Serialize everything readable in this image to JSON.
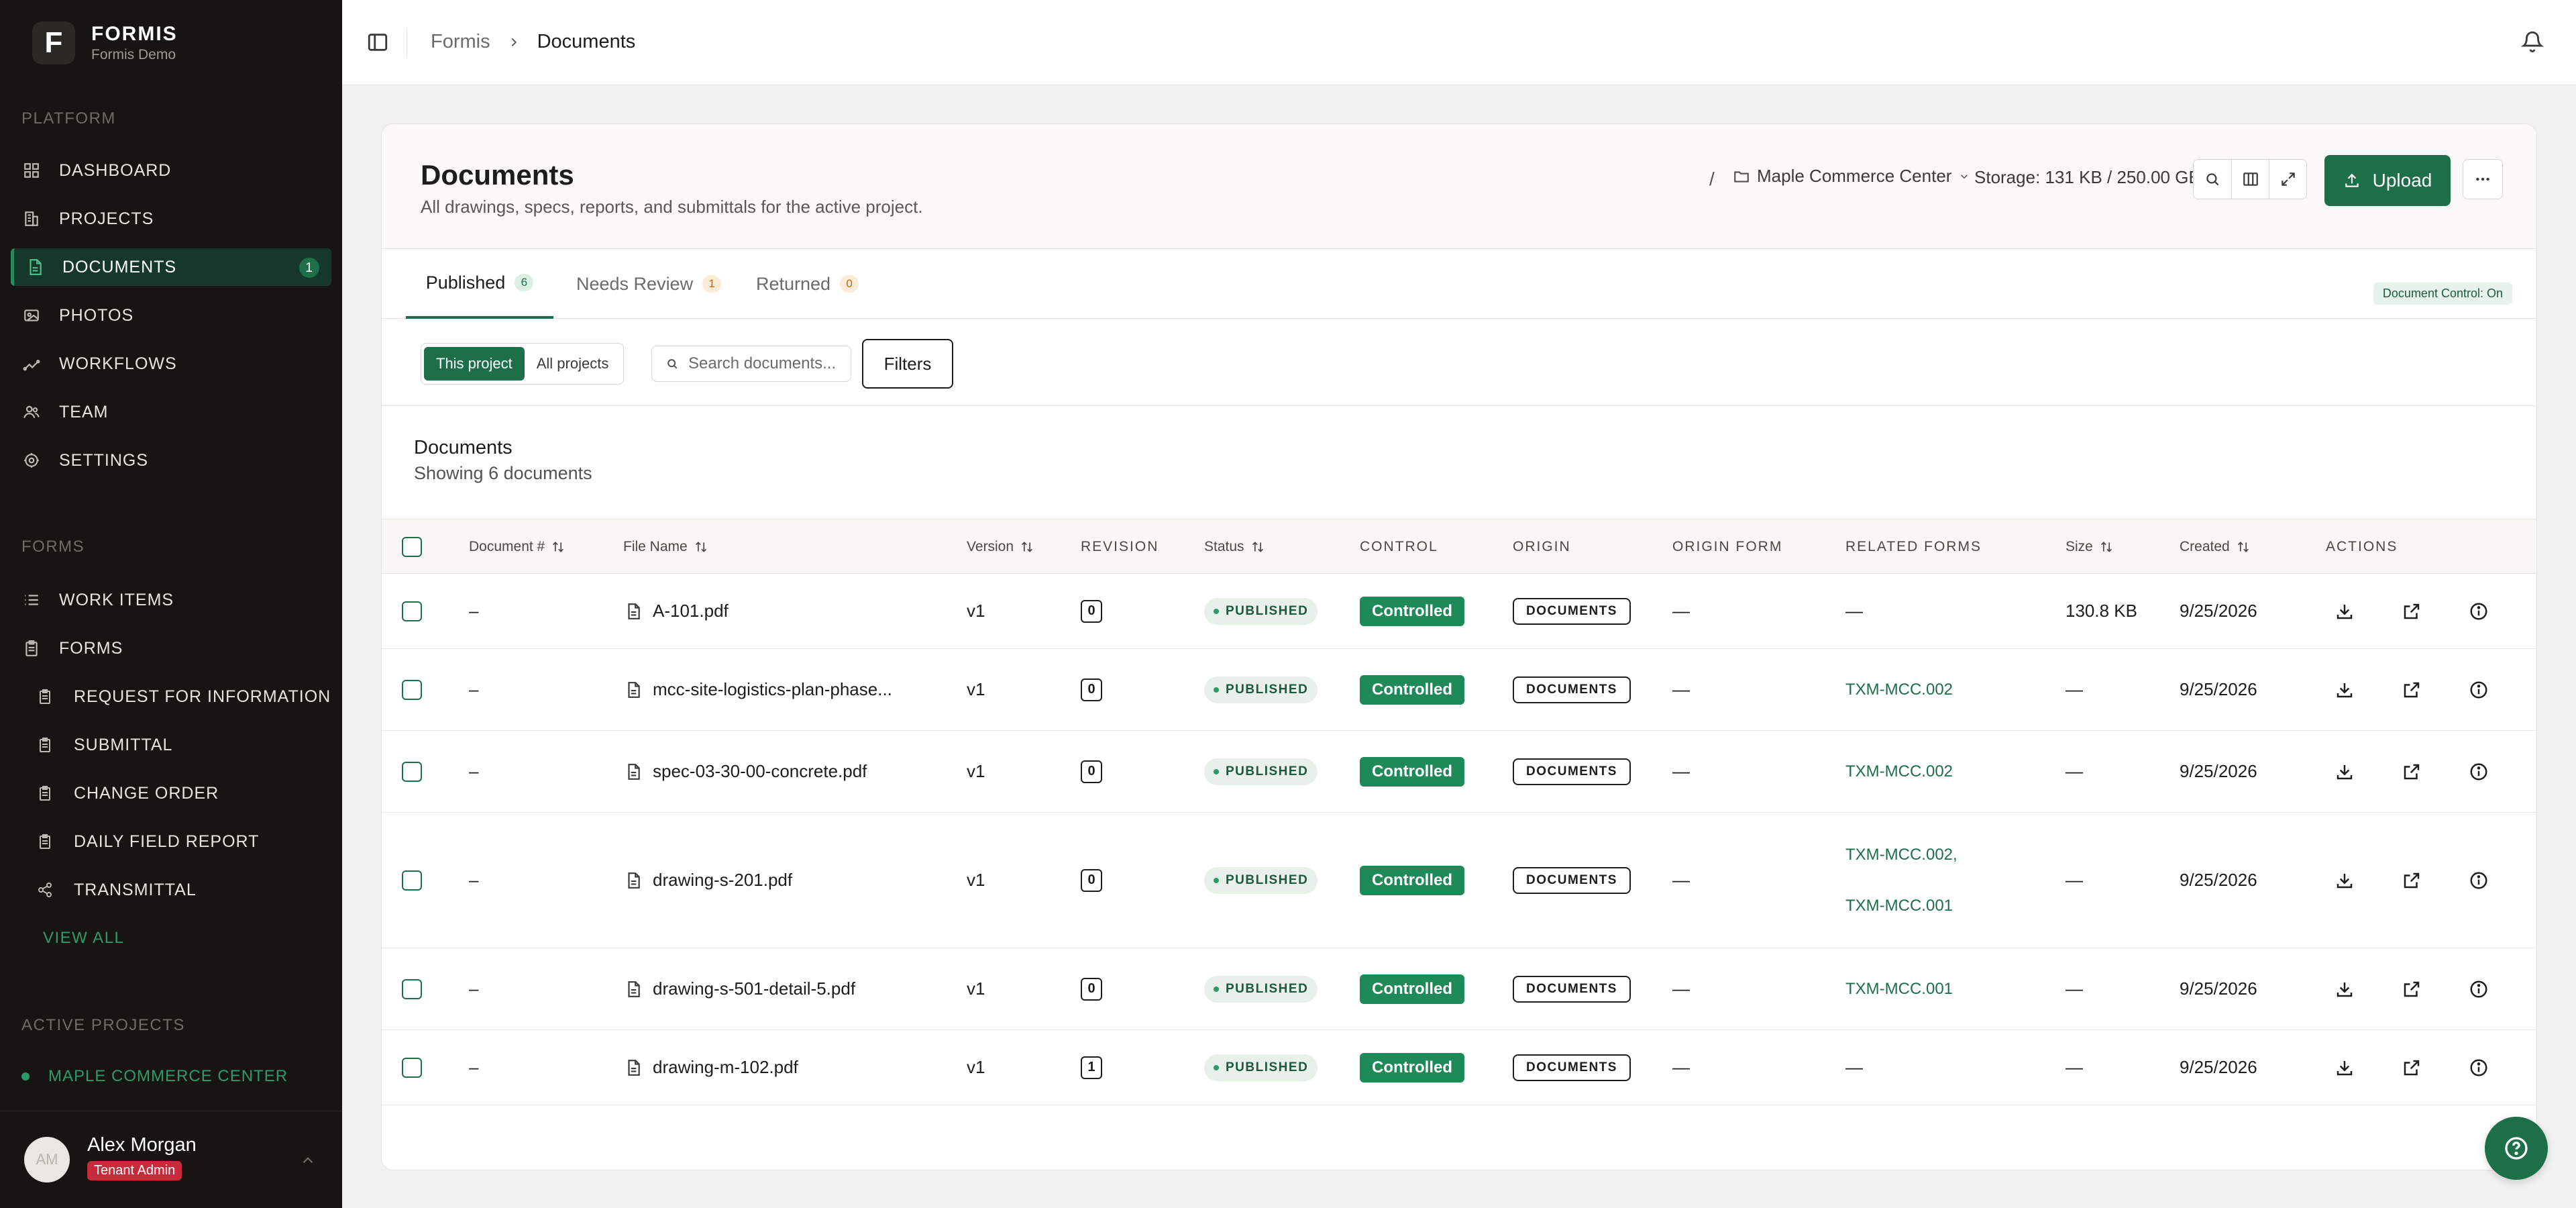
{
  "brand": {
    "logo_letter": "F",
    "name": "FORMIS",
    "tenant": "Formis Demo"
  },
  "sidebar": {
    "platform_heading": "PLATFORM",
    "platform_items": [
      {
        "label": "DASHBOARD",
        "icon": "grid-icon"
      },
      {
        "label": "PROJECTS",
        "icon": "building-icon"
      },
      {
        "label": "DOCUMENTS",
        "icon": "document-icon",
        "badge": "1",
        "active": true
      },
      {
        "label": "PHOTOS",
        "icon": "photo-icon"
      },
      {
        "label": "WORKFLOWS",
        "icon": "workflow-icon"
      },
      {
        "label": "TEAM",
        "icon": "team-icon"
      },
      {
        "label": "SETTINGS",
        "icon": "gear-icon"
      }
    ],
    "forms_heading": "FORMS",
    "forms_items": [
      {
        "label": "WORK ITEMS",
        "icon": "list-icon"
      },
      {
        "label": "FORMS",
        "icon": "clipboard-icon"
      }
    ],
    "form_sub_items": [
      {
        "label": "REQUEST FOR INFORMATION",
        "icon": "clipboard-icon"
      },
      {
        "label": "SUBMITTAL",
        "icon": "clipboard-icon"
      },
      {
        "label": "CHANGE ORDER",
        "icon": "clipboard-icon"
      },
      {
        "label": "DAILY FIELD REPORT",
        "icon": "clipboard-icon"
      },
      {
        "label": "TRANSMITTAL",
        "icon": "share-icon"
      }
    ],
    "view_all": "VIEW ALL",
    "active_projects_heading": "ACTIVE PROJECTS",
    "active_project": "MAPLE COMMERCE CENTER"
  },
  "user": {
    "initials": "AM",
    "name": "Alex Morgan",
    "role": "Tenant Admin"
  },
  "breadcrumb": {
    "root": "Formis",
    "current": "Documents"
  },
  "header": {
    "title": "Documents",
    "subtitle": "All drawings, specs, reports, and submittals for the active project.",
    "slash": "/",
    "project": "Maple Commerce Center",
    "storage": "Storage: 131 KB / 250.00 GB",
    "upload_label": "Upload"
  },
  "tabs": [
    {
      "label": "Published",
      "count": "6",
      "active": true
    },
    {
      "label": "Needs Review",
      "count": "1"
    },
    {
      "label": "Returned",
      "count": "0"
    }
  ],
  "document_control": "Document Control: On",
  "filters": {
    "scope_this": "This project",
    "scope_all": "All projects",
    "search_placeholder": "Search documents...",
    "filters_label": "Filters"
  },
  "list": {
    "title": "Documents",
    "subtitle": "Showing 6 documents"
  },
  "table": {
    "columns": {
      "doc_no": "Document #",
      "file_name": "File Name",
      "version": "Version",
      "revision": "REVISION",
      "status": "Status",
      "control": "CONTROL",
      "origin": "ORIGIN",
      "origin_form": "ORIGIN FORM",
      "related": "RELATED FORMS",
      "size": "Size",
      "created": "Created",
      "actions": "ACTIONS"
    },
    "rows": [
      {
        "doc_no": "–",
        "file_name": "A-101.pdf",
        "version": "v1",
        "revision": "0",
        "status": "PUBLISHED",
        "control": "Controlled",
        "origin": "DOCUMENTS",
        "origin_form": "—",
        "related": [
          "—"
        ],
        "size": "130.8 KB",
        "created": "9/25/2026"
      },
      {
        "doc_no": "–",
        "file_name": "mcc-site-logistics-plan-phase...",
        "version": "v1",
        "revision": "0",
        "status": "PUBLISHED",
        "control": "Controlled",
        "origin": "DOCUMENTS",
        "origin_form": "—",
        "related": [
          "TXM-MCC.002"
        ],
        "size": "—",
        "created": "9/25/2026"
      },
      {
        "doc_no": "–",
        "file_name": "spec-03-30-00-concrete.pdf",
        "version": "v1",
        "revision": "0",
        "status": "PUBLISHED",
        "control": "Controlled",
        "origin": "DOCUMENTS",
        "origin_form": "—",
        "related": [
          "TXM-MCC.002"
        ],
        "size": "—",
        "created": "9/25/2026"
      },
      {
        "doc_no": "–",
        "file_name": "drawing-s-201.pdf",
        "version": "v1",
        "revision": "0",
        "status": "PUBLISHED",
        "control": "Controlled",
        "origin": "DOCUMENTS",
        "origin_form": "—",
        "related": [
          "TXM-MCC.002,",
          "TXM-MCC.001"
        ],
        "size": "—",
        "created": "9/25/2026"
      },
      {
        "doc_no": "–",
        "file_name": "drawing-s-501-detail-5.pdf",
        "version": "v1",
        "revision": "0",
        "status": "PUBLISHED",
        "control": "Controlled",
        "origin": "DOCUMENTS",
        "origin_form": "—",
        "related": [
          "TXM-MCC.001"
        ],
        "size": "—",
        "created": "9/25/2026"
      },
      {
        "doc_no": "–",
        "file_name": "drawing-m-102.pdf",
        "version": "v1",
        "revision": "1",
        "status": "PUBLISHED",
        "control": "Controlled",
        "origin": "DOCUMENTS",
        "origin_form": "—",
        "related": [
          "—"
        ],
        "size": "—",
        "created": "9/25/2026"
      }
    ]
  },
  "colors": {
    "accent": "#1d6f4a",
    "sidebar_bg": "#171511",
    "control_badge": "#1d8a58",
    "role_badge": "#c72a3a"
  }
}
